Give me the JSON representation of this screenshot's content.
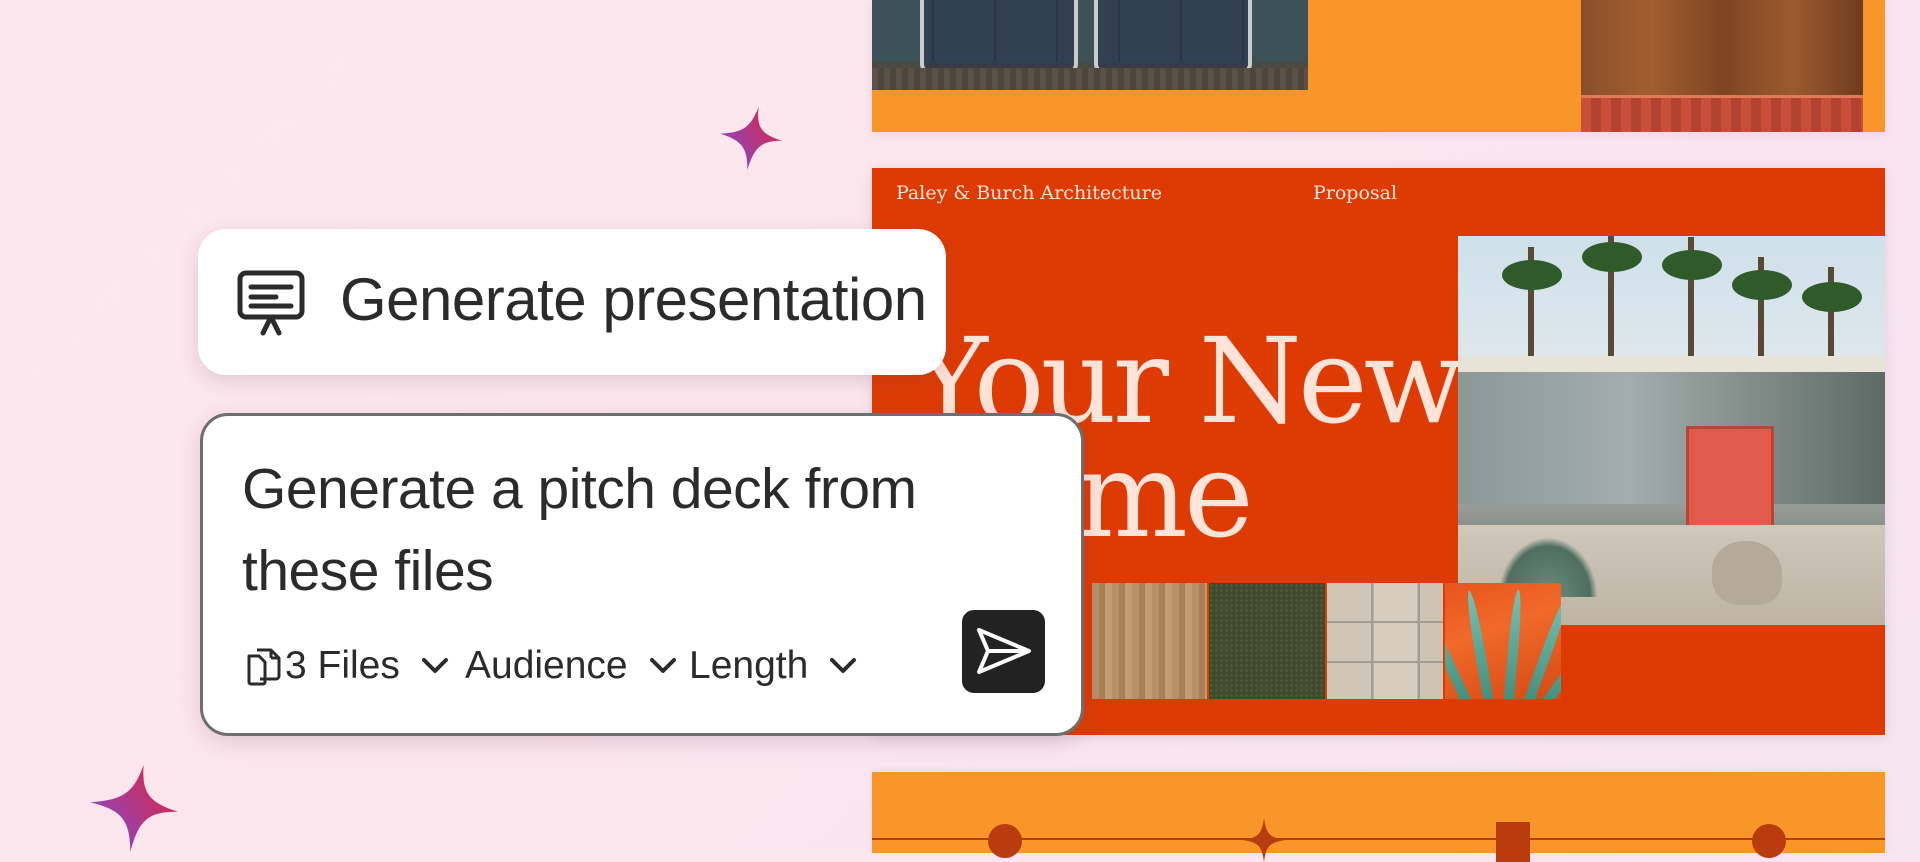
{
  "chip": {
    "icon": "presentation-icon",
    "label": "Generate presentation"
  },
  "prompt": {
    "text_line1": "Generate a pitch deck from",
    "text_line2": "these files",
    "options": [
      {
        "icon": "files-icon",
        "label": "3 Files"
      },
      {
        "label": "Audience"
      },
      {
        "label": "Length"
      }
    ],
    "send_icon": "send-icon"
  },
  "slide": {
    "company": "Paley & Burch Architecture",
    "section": "Proposal",
    "headline_line1": "Your New",
    "headline_line2": "Home"
  },
  "colors": {
    "slide_orange": "#dd3b03",
    "light_orange": "#f8962a",
    "sparkle_start": "#7b4dd6",
    "sparkle_end": "#e5233a"
  }
}
